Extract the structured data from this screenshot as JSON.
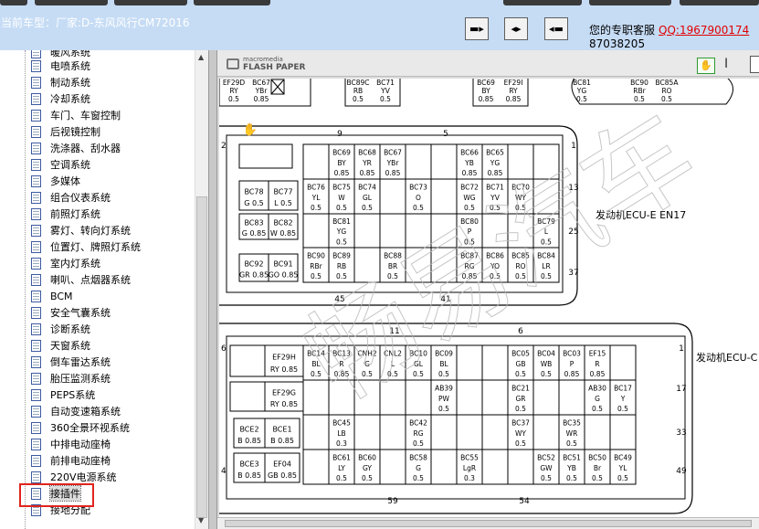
{
  "header": {
    "current_model_label": "当前车型：厂家:D-东风风行CM72016",
    "nav_buttons": [
      "prev-icon",
      "both-panels-icon",
      "next-icon"
    ],
    "service_label": "您的专职客服",
    "service_qq": "QQ:1967900174",
    "service_phone": "87038205"
  },
  "tree": {
    "partial_top": "暖风系统",
    "items": [
      "电喷系统",
      "制动系统",
      "冷却系统",
      "车门、车窗控制",
      "后视镜控制",
      "洗涤器、刮水器",
      "空调系统",
      "多媒体",
      "组合仪表系统",
      "前照灯系统",
      "雾灯、转向灯系统",
      "位置灯、牌照灯系统",
      "室内灯系统",
      "喇叭、点烟器系统",
      "BCM",
      "安全气囊系统",
      "诊断系统",
      "天窗系统",
      "倒车雷达系统",
      "胎压监测系统",
      "PEPS系统",
      "自动变速箱系统",
      "360全景环视系统",
      "中排电动座椅",
      "前排电动座椅",
      "220V电源系统",
      "接插件",
      "接地分配"
    ],
    "selected": "接插件"
  },
  "viewer": {
    "logo_line1": "macromedia",
    "logo_line2": "FLASH PAPER",
    "tools": [
      "hand-tool-icon",
      "text-select-icon",
      "page-icon"
    ]
  },
  "diagram": {
    "watermark": "畅易汽车",
    "top_row": [
      {
        "code": "EF29D",
        "color": "RY",
        "size": "0.5"
      },
      {
        "code": "BC67",
        "color": "YBr",
        "size": "0.85"
      },
      {
        "code": "BC89C",
        "color": "RB",
        "size": "0.5"
      },
      {
        "code": "BC71",
        "color": "YV",
        "size": "0.5"
      },
      {
        "code": "BC69",
        "color": "BY",
        "size": "0.85"
      },
      {
        "code": "EF29I",
        "color": "RY",
        "size": "0.85"
      },
      {
        "code": "BC81",
        "color": "YG",
        "size": "0.5"
      },
      {
        "code": "BC90",
        "color": "RBr",
        "size": "0.5"
      },
      {
        "code": "BC85A",
        "color": "RO",
        "size": "0.5"
      }
    ],
    "connector1": {
      "label": "发动机ECU-E  EN17",
      "pin_numbers": {
        "top_left": "9",
        "top_right": "5",
        "bottom_left": "45",
        "bottom_right": "41",
        "right_1": "1",
        "right_13": "13",
        "right_25": "25",
        "right_37": "37",
        "left_2": "2"
      },
      "left_cells": [
        {
          "code": "BC78",
          "color": "G",
          "size": "0.5"
        },
        {
          "code": "BC77",
          "color": "L",
          "size": "0.5"
        },
        {
          "code": "BC83",
          "color": "G",
          "size": "0.85"
        },
        {
          "code": "BC82",
          "color": "W",
          "size": "0.85"
        },
        {
          "code": "BC92",
          "color": "GR",
          "size": "0.85"
        },
        {
          "code": "BC91",
          "color": "GO",
          "size": "0.85"
        }
      ],
      "grid": [
        [
          null,
          {
            "code": "BC69",
            "color": "BY",
            "size": "0.85"
          },
          {
            "code": "BC68",
            "color": "YR",
            "size": "0.85"
          },
          {
            "code": "BC67",
            "color": "YBr",
            "size": "0.85"
          },
          null,
          null,
          {
            "code": "BC66",
            "color": "YB",
            "size": "0.85"
          },
          {
            "code": "BC65",
            "color": "YG",
            "size": "0.85"
          },
          null,
          null
        ],
        [
          {
            "code": "BC76",
            "color": "YL",
            "size": "0.5"
          },
          {
            "code": "BC75",
            "color": "W",
            "size": "0.5"
          },
          {
            "code": "BC74",
            "color": "GL",
            "size": "0.5"
          },
          null,
          {
            "code": "BC73",
            "color": "O",
            "size": "0.5"
          },
          null,
          {
            "code": "BC72",
            "color": "WG",
            "size": "0.5"
          },
          {
            "code": "BC71",
            "color": "YV",
            "size": "0.5"
          },
          {
            "code": "BC70",
            "color": "WY",
            "size": "0.5"
          },
          null
        ],
        [
          null,
          {
            "code": "BC81",
            "color": "YG",
            "size": "0.5"
          },
          null,
          null,
          null,
          null,
          {
            "code": "BC80",
            "color": "P",
            "size": "0.5"
          },
          null,
          null,
          {
            "code": "BC79",
            "color": "L",
            "size": "0.5"
          }
        ],
        [
          {
            "code": "BC90",
            "color": "RBr",
            "size": "0.5"
          },
          {
            "code": "BC89",
            "color": "RB",
            "size": "0.5"
          },
          null,
          {
            "code": "BC88",
            "color": "BR",
            "size": "0.5"
          },
          null,
          null,
          {
            "code": "BC87",
            "color": "RG",
            "size": "0.85"
          },
          {
            "code": "BC86",
            "color": "YO",
            "size": "0.5"
          },
          {
            "code": "BC85",
            "color": "RO",
            "size": "0.5"
          },
          {
            "code": "BC84",
            "color": "LR",
            "size": "0.5"
          }
        ]
      ]
    },
    "connector2": {
      "label": "发动机ECU-C",
      "pin_numbers": {
        "top_left": "11",
        "top_right": "6",
        "bottom_left": "59",
        "bottom_right": "54",
        "right_1": "1",
        "right_17": "17",
        "right_33": "33",
        "right_49": "49",
        "left_6": "6",
        "left_4": "4"
      },
      "left_cells": [
        {
          "code": "EF29H",
          "color": "RY",
          "size": "0.85"
        },
        {
          "code": "EF29G",
          "color": "RY",
          "size": "0.85"
        },
        {
          "code": "BCE2",
          "color": "B",
          "size": "0.85"
        },
        {
          "code": "BCE1",
          "color": "B",
          "size": "0.85"
        },
        {
          "code": "BCE3",
          "color": "B",
          "size": "0.85"
        },
        {
          "code": "EF04",
          "color": "GB",
          "size": "0.85"
        }
      ],
      "grid": [
        [
          {
            "code": "BC14",
            "color": "BL",
            "size": "0.5"
          },
          {
            "code": "BC13",
            "color": "R",
            "size": "0.85"
          },
          {
            "code": "CNH2",
            "color": "G",
            "size": "0.5"
          },
          {
            "code": "CNL2",
            "color": "L",
            "size": "0.5"
          },
          {
            "code": "BC10",
            "color": "GL",
            "size": "0.5"
          },
          {
            "code": "BC09",
            "color": "BL",
            "size": "0.5"
          },
          null,
          null,
          {
            "code": "BC05",
            "color": "GB",
            "size": "0.5"
          },
          {
            "code": "BC04",
            "color": "WB",
            "size": "0.5"
          },
          {
            "code": "BC03",
            "color": "P",
            "size": "0.85"
          },
          {
            "code": "EF15",
            "color": "R",
            "size": "0.85"
          },
          null
        ],
        [
          null,
          null,
          null,
          null,
          null,
          {
            "code": "AB39",
            "color": "PW",
            "size": "0.5"
          },
          null,
          null,
          {
            "code": "BC21",
            "color": "GR",
            "size": "0.5"
          },
          null,
          null,
          {
            "code": "AB30",
            "color": "G",
            "size": "0.5"
          },
          {
            "code": "BC17",
            "color": "Y",
            "size": "0.5"
          }
        ],
        [
          null,
          {
            "code": "BC45",
            "color": "LB",
            "size": "0.3"
          },
          null,
          null,
          {
            "code": "BC42",
            "color": "RG",
            "size": "0.5"
          },
          null,
          null,
          null,
          {
            "code": "BC37",
            "color": "WY",
            "size": "0.5"
          },
          null,
          {
            "code": "BC35",
            "color": "WR",
            "size": "0.5"
          },
          null,
          null
        ],
        [
          null,
          {
            "code": "BC61",
            "color": "LY",
            "size": "0.5"
          },
          {
            "code": "BC60",
            "color": "GY",
            "size": "0.5"
          },
          null,
          {
            "code": "BC58",
            "color": "G",
            "size": "0.5"
          },
          null,
          {
            "code": "BC55",
            "color": "LgR",
            "size": "0.3"
          },
          null,
          null,
          {
            "code": "BC52",
            "color": "GW",
            "size": "0.5"
          },
          {
            "code": "BC51",
            "color": "YB",
            "size": "0.5"
          },
          {
            "code": "BC50",
            "color": "Br",
            "size": "0.5"
          },
          {
            "code": "BC49",
            "color": "YL",
            "size": "0.5"
          }
        ]
      ]
    }
  }
}
